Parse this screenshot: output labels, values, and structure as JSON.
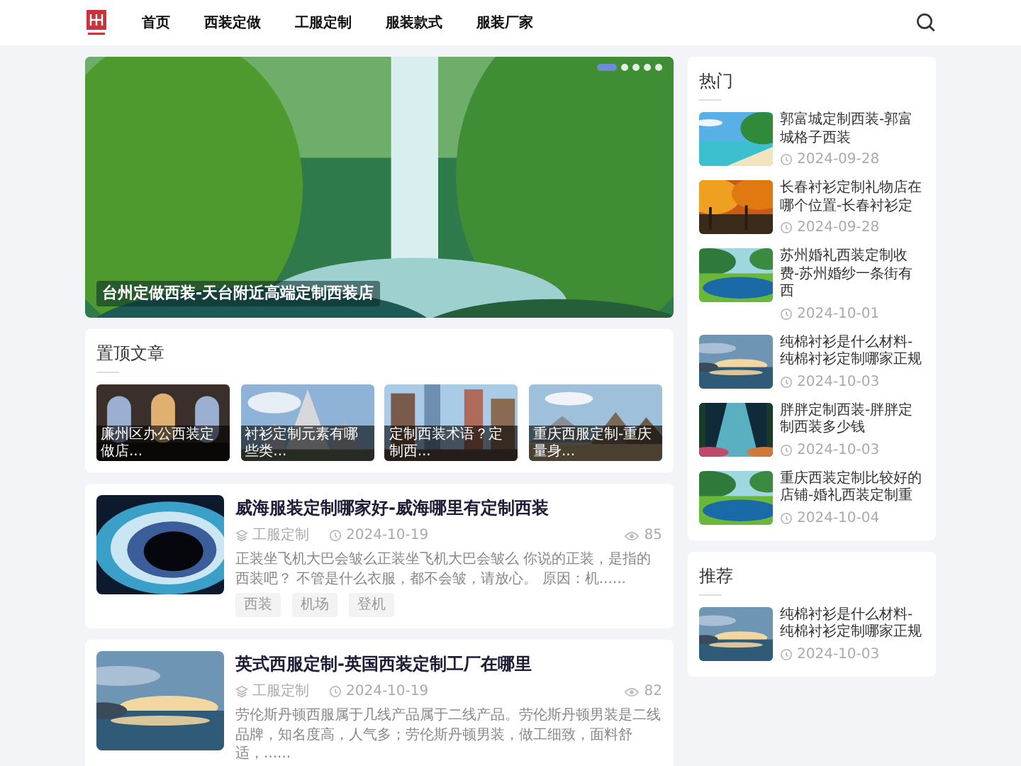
{
  "header": {
    "nav": [
      "首页",
      "西装定做",
      "工服定制",
      "服装款式",
      "服装厂家"
    ]
  },
  "hero": {
    "caption": "台州定做西装-天台附近高端定制西装店",
    "dots": [
      {
        "selected": true
      },
      {
        "selected": false
      },
      {
        "selected": false
      },
      {
        "selected": false
      },
      {
        "selected": false
      }
    ]
  },
  "pinned": {
    "title": "置顶文章",
    "items": [
      {
        "caption": "廉州区办公西装定做店..."
      },
      {
        "caption": "衬衫定制元素有哪些类..."
      },
      {
        "caption": "定制西装术语？定制西..."
      },
      {
        "caption": "重庆西服定制-重庆量身..."
      }
    ]
  },
  "articles": [
    {
      "title": "威海服装定制哪家好-威海哪里有定制西装",
      "category": "工服定制",
      "date": "2024-10-19",
      "views": "85",
      "excerpt": "正装坐飞机大巴会皱么正装坐飞机大巴会皱么 你说的正装，是指的西装吧？ 不管是什么衣服，都不会皱，请放心。 原因：机......",
      "tags": [
        "西装",
        "机场",
        "登机"
      ]
    },
    {
      "title": "英式西服定制-英国西装定制工厂在哪里",
      "category": "工服定制",
      "date": "2024-10-19",
      "views": "82",
      "excerpt": "劳伦斯丹顿西服属于几线产品属于二线产品。劳伦斯丹顿男装是二线品牌，知名度高，人气多；劳伦斯丹顿男装，做工细致，面料舒适，......"
    }
  ],
  "hot": {
    "title": "热门",
    "items": [
      {
        "title": "郭富城定制西装-郭富城格子西装",
        "date": "2024-09-28"
      },
      {
        "title": "长春衬衫定制礼物店在哪个位置-长春衬衫定",
        "date": "2024-09-28"
      },
      {
        "title": "苏州婚礼西装定制收费-苏州婚纱一条街有西",
        "date": "2024-10-01"
      },
      {
        "title": "纯棉衬衫是什么材料-纯棉衬衫定制哪家正规",
        "date": "2024-10-03"
      },
      {
        "title": "胖胖定制西装-胖胖定制西装多少钱",
        "date": "2024-10-03"
      },
      {
        "title": "重庆西装定制比较好的店铺-婚礼西装定制重",
        "date": "2024-10-04"
      }
    ]
  },
  "recommend": {
    "title": "推荐",
    "items": [
      {
        "title": "纯棉衬衫是什么材料-纯棉衬衫定制哪家正规",
        "date": "2024-10-03"
      }
    ]
  }
}
